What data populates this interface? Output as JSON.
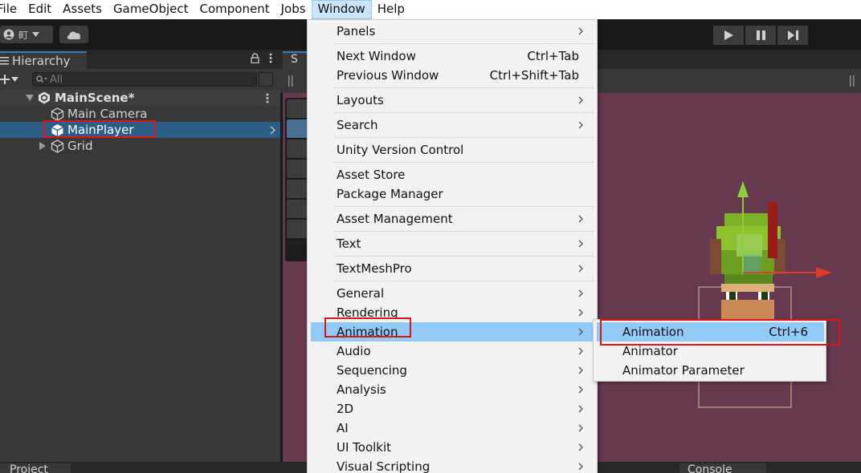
{
  "menubar": {
    "items": [
      "File",
      "Edit",
      "Assets",
      "GameObject",
      "Component",
      "Jobs",
      "Window",
      "Help"
    ],
    "active": "Window"
  },
  "toolbar": {
    "account_text": "町",
    "play_icon": "play-icon",
    "pause_icon": "pause-icon",
    "step_icon": "step-icon"
  },
  "hierarchy": {
    "tab_label": "Hierarchy",
    "search_placeholder": "All",
    "scene_name": "MainScene*",
    "items": [
      {
        "label": "Main Camera",
        "selected": false,
        "expandable": false
      },
      {
        "label": "MainPlayer",
        "selected": true,
        "expandable": false
      },
      {
        "label": "Grid",
        "selected": false,
        "expandable": true
      }
    ]
  },
  "scene": {
    "tab_label": "S",
    "background": "#66394f"
  },
  "window_menu": {
    "items": [
      {
        "label": "Panels",
        "shortcut": "",
        "submenu": true
      },
      {
        "label": "Next Window",
        "shortcut": "Ctrl+Tab",
        "submenu": false
      },
      {
        "label": "Previous Window",
        "shortcut": "Ctrl+Shift+Tab",
        "submenu": false
      },
      {
        "label": "Layouts",
        "shortcut": "",
        "submenu": true
      },
      {
        "label": "Search",
        "shortcut": "",
        "submenu": true
      },
      {
        "label": "Unity Version Control",
        "shortcut": "",
        "submenu": false
      },
      {
        "label": "Asset Store",
        "shortcut": "",
        "submenu": false
      },
      {
        "label": "Package Manager",
        "shortcut": "",
        "submenu": false
      },
      {
        "label": "Asset Management",
        "shortcut": "",
        "submenu": true
      },
      {
        "label": "Text",
        "shortcut": "",
        "submenu": true
      },
      {
        "label": "TextMeshPro",
        "shortcut": "",
        "submenu": true
      },
      {
        "label": "General",
        "shortcut": "",
        "submenu": true
      },
      {
        "label": "Rendering",
        "shortcut": "",
        "submenu": true
      },
      {
        "label": "Animation",
        "shortcut": "",
        "submenu": true,
        "highlighted": true
      },
      {
        "label": "Audio",
        "shortcut": "",
        "submenu": true
      },
      {
        "label": "Sequencing",
        "shortcut": "",
        "submenu": true
      },
      {
        "label": "Analysis",
        "shortcut": "",
        "submenu": true
      },
      {
        "label": "2D",
        "shortcut": "",
        "submenu": true
      },
      {
        "label": "AI",
        "shortcut": "",
        "submenu": true
      },
      {
        "label": "UI Toolkit",
        "shortcut": "",
        "submenu": true
      },
      {
        "label": "Visual Scripting",
        "shortcut": "",
        "submenu": true
      }
    ]
  },
  "animation_submenu": {
    "items": [
      {
        "label": "Animation",
        "shortcut": "Ctrl+6",
        "highlighted": true
      },
      {
        "label": "Animator",
        "shortcut": ""
      },
      {
        "label": "Animator Parameter",
        "shortcut": ""
      }
    ]
  },
  "bottom": {
    "project_tab": "Project",
    "console_tab": "Console"
  },
  "colors": {
    "highlight": "#91c9f7",
    "selection": "#2c5d87",
    "annotation_red": "#e01414"
  }
}
